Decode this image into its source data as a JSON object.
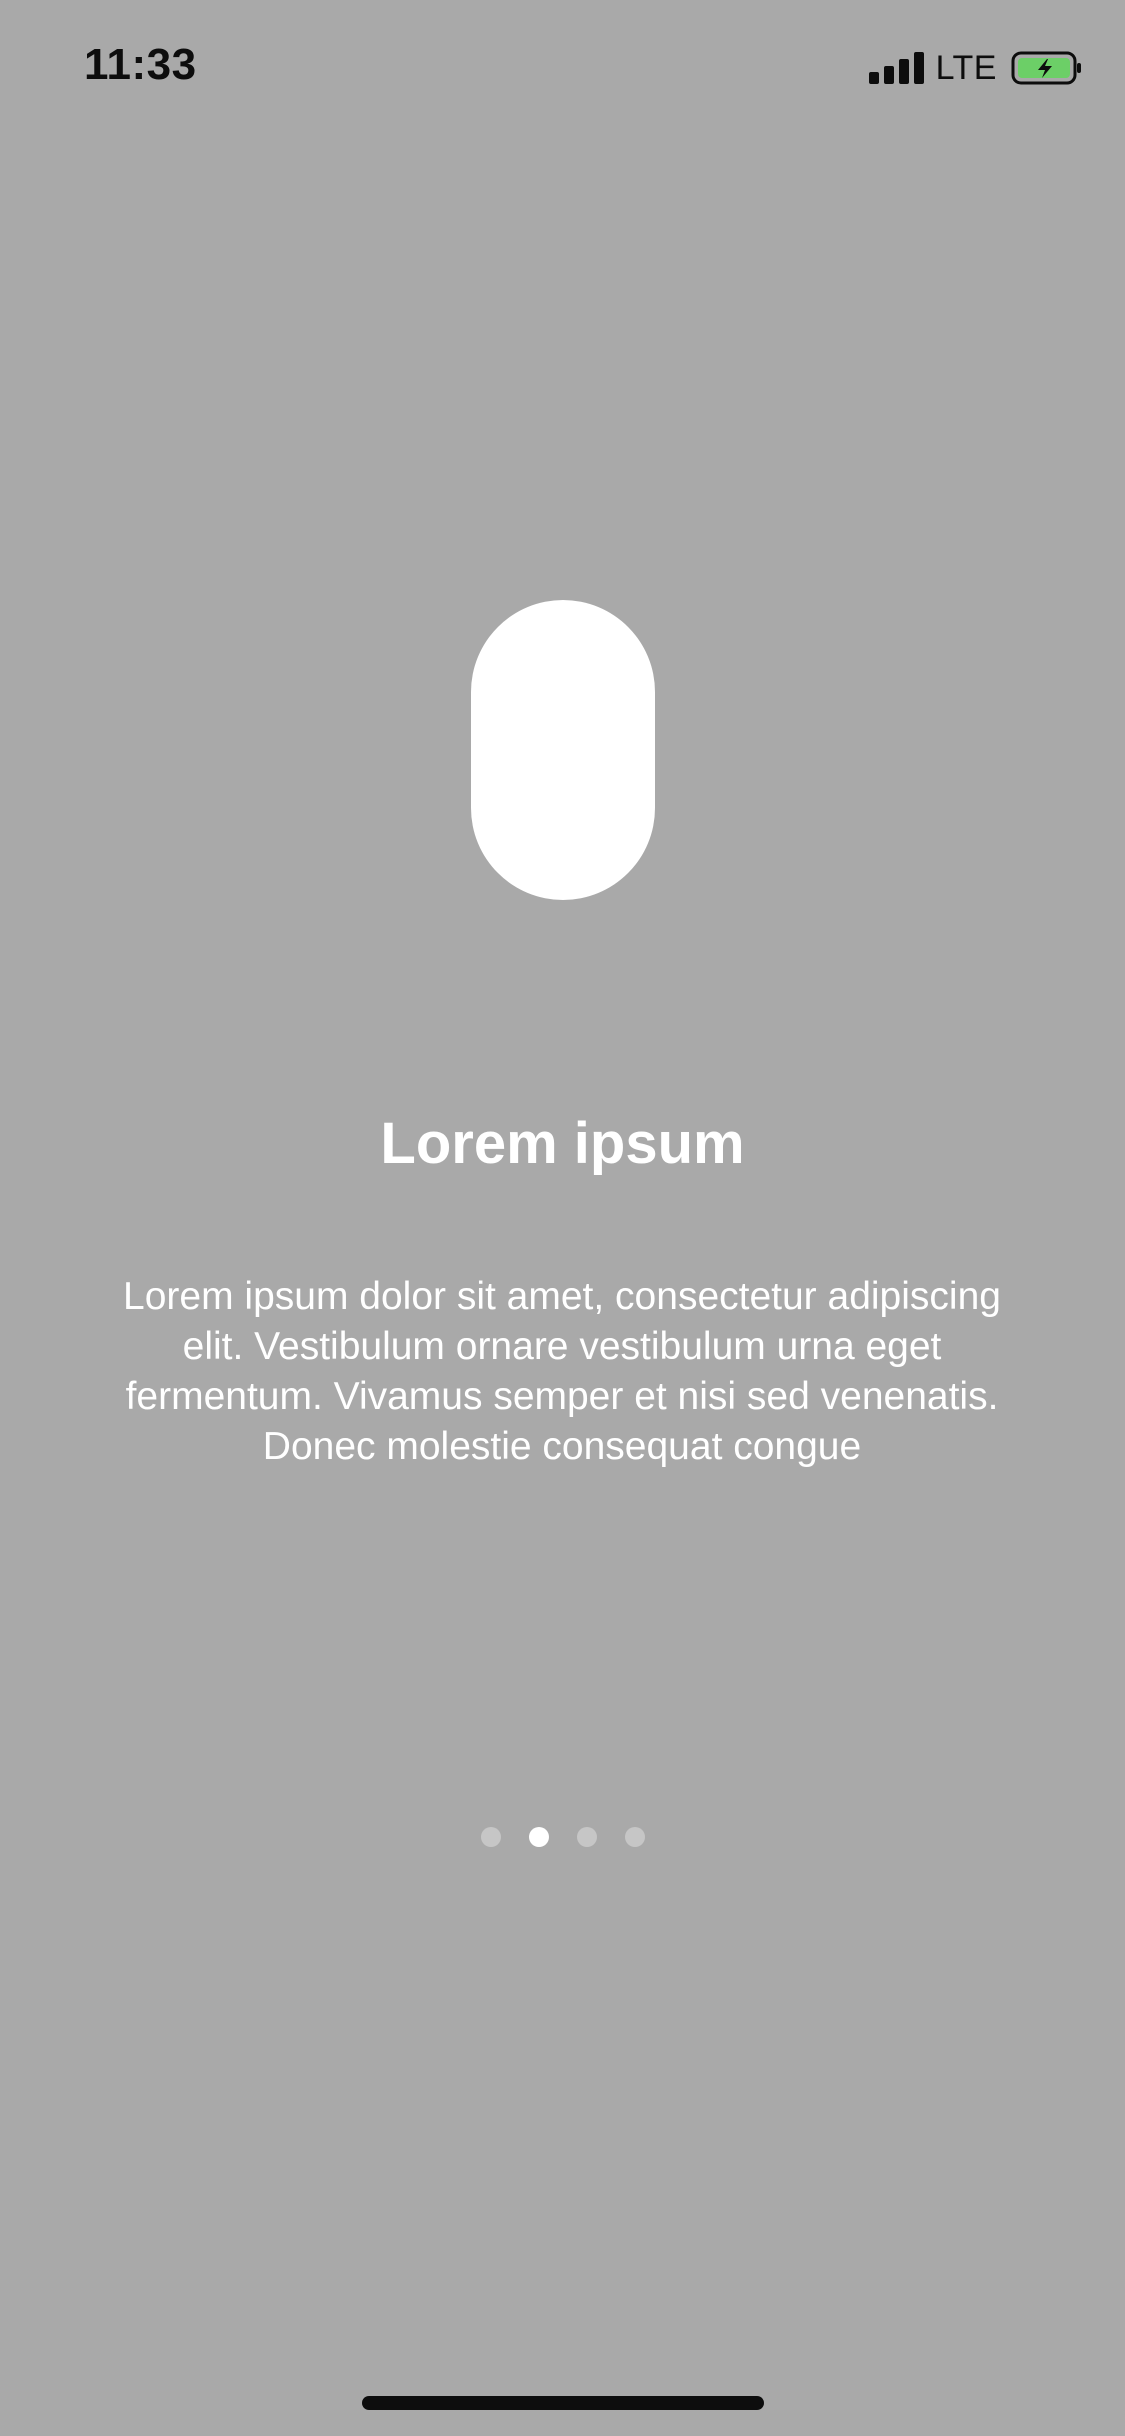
{
  "status_bar": {
    "time": "11:33",
    "network": "LTE",
    "battery_color": "#6ccf67"
  },
  "onboarding": {
    "title": "Lorem ipsum",
    "body": "Lorem ipsum dolor sit amet, consectetur adipiscing elit. Vestibulum ornare vestibulum urna eget fermentum. Vivamus semper et nisi sed venenatis. Donec molestie consequat congue",
    "page_count": 4,
    "current_page": 2
  },
  "colors": {
    "background": "#a9a9a9",
    "text": "#ffffff",
    "dot_inactive": "#c6c6c6",
    "dot_active": "#ffffff"
  }
}
